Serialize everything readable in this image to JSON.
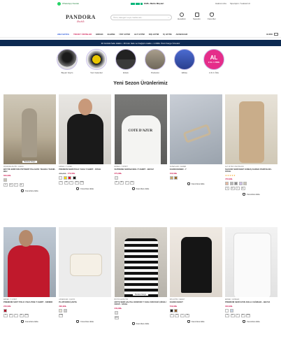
{
  "topbar": {
    "whatsapp": "WhatsApp Destek",
    "trustpilot": "1628+ Mutlu Müşteri",
    "links": [
      "Hakkımızda",
      "Siparişimi / İadeleriniz"
    ]
  },
  "logo": {
    "main": "PANDORA",
    "sub": "Butik"
  },
  "search": {
    "placeholder": "Ürün, kategori veya marka ara..."
  },
  "header_icons": [
    {
      "name": "user",
      "label": "Hesabım"
    },
    {
      "name": "bag",
      "label": "Sepetim"
    },
    {
      "name": "heart",
      "label": "Favoriler"
    }
  ],
  "nav": {
    "items": [
      "ANA SAYFA",
      "TRIVET ÜRÜNLER",
      "ERKEK",
      "ELBİSE",
      "ÜST GİYİM",
      "ALT GİYİM",
      "DIŞ GİYİM",
      "İÇ GİYİM",
      "AKSESUAR"
    ],
    "lang": "EURO",
    "flag": "TR"
  },
  "promo": {
    "text": "30 Günlük İade Hakkı • 18 Gün İade ve Değişim Hakkı • 1.000₺ Üzeri Kargo Ücretsiz"
  },
  "categories": [
    "Beyaz Giyim",
    "Yeni Gelenler",
    "Erkek",
    "Pantolon",
    "Elbise",
    "2 Al 1 Öde"
  ],
  "promo_cat": {
    "big": "AL",
    "small": "2 AL 1 ÖDE"
  },
  "section_title": "Yeni Sezon Ürünlerimiz",
  "row1": [
    {
      "brand": "PANDORA BUTİK / KADIN",
      "name": "BÜYÜK EDİSYON POTDERT PALAZZO YELEKLİ TAKIM - BEJ",
      "price": "849,99₺",
      "old": "",
      "tag": "Bedava Kargo",
      "stars": "",
      "colors": [
        "#c9c3b5"
      ],
      "sizes": [
        "S",
        "M",
        "L",
        "XL"
      ]
    },
    {
      "brand": "ERKEK / T-SHIRT",
      "name": "PREMIUM SERİ POLO YAKA T-SHIRT - SİYAH",
      "price": "279,99₺",
      "old": "399,99₺",
      "tag": "",
      "stars": "",
      "colors": [
        "#f2f2f2",
        "#f5d800",
        "#d81b28",
        "#111111"
      ],
      "sizes": [
        "S",
        "M",
        "L",
        "XL",
        "XXL"
      ]
    },
    {
      "brand": "ERKEK / T-SHIRT",
      "name": "SUPREME SERİ BASKILI T-SHIRT - BEYAZ",
      "price": "279,99₺",
      "old": "",
      "tag": "",
      "stars": "",
      "colors": [
        "#e8e8e8"
      ],
      "sizes": [
        "S",
        "M",
        "L",
        "XL"
      ]
    },
    {
      "brand": "AKSESUAR / KEMER",
      "name": "KADIN KEMER - Y",
      "price": "199,99₺",
      "old": "",
      "tag": "",
      "stars": "",
      "colors": [
        "#c8a56a",
        "#9a6a2c"
      ],
      "sizes": []
    },
    {
      "brand": "ALT GİYİM / PANTOLON",
      "name": "SALVOR SERİ KEEP KUMAŞ KARGO PANTOLON - SİYAH",
      "price": "479,99₺",
      "old": "",
      "tag": "",
      "stars": "★★★★★",
      "colors": [
        "#e5b8a0",
        "#b7b7b7",
        "#8a8a8a",
        "#cfc0e6",
        "#c9c3b5"
      ],
      "sizes": [
        "S",
        "M",
        "L",
        "XL"
      ]
    }
  ],
  "row2": [
    {
      "brand": "ERKEK / T-SHIRT",
      "name": "PREMIUM SOFT POLO YAKA PIKE T-SHIRT - KIRMIZI",
      "price": "249,99₺",
      "old": "",
      "tag": "",
      "stars": "",
      "colors": [
        "#b3122a"
      ],
      "sizes": [
        "S",
        "M",
        "L",
        "XL",
        "XXL"
      ]
    },
    {
      "brand": "AKSESUAR / ÇANTA",
      "name": "PLATFORM ÇANTA",
      "price": "399,99₺",
      "old": "",
      "tag": "",
      "stars": "",
      "colors": [
        "#e8e2d6",
        "#cfcfcf"
      ],
      "sizes": [
        "STD"
      ]
    },
    {
      "brand": "BÜYÜK EDİSYON",
      "name": "ÇİFTE SERİ HALTAL KONFOR T-YAKA KRUVAZİ ÇİZGİLİ CROP - SİYAH",
      "price": "349,99₺",
      "old": "",
      "tag": "Bedava Kargo",
      "stars": "",
      "colors": [
        "#e0e0e0"
      ],
      "sizes": [
        "STD"
      ]
    },
    {
      "brand": "DIŞ GİYİM / CEKET",
      "name": "KADIN CEKET",
      "price": "549,99₺",
      "old": "",
      "tag": "",
      "stars": "",
      "colors": [
        "#1a1a1a",
        "#8a5a2a"
      ],
      "sizes": [
        "S",
        "M",
        "L",
        "XL"
      ]
    },
    {
      "brand": "ERKEK / GÖMLEK",
      "name": "PREMIUM SERİ UZUN KOLLU GÖMLEK - BEYAZ",
      "price": "349,99₺",
      "old": "",
      "tag": "",
      "stars": "",
      "colors": [
        "#ffffff",
        "#c8d4e6"
      ],
      "sizes": [
        "S",
        "M",
        "L",
        "XL",
        "XXL"
      ]
    }
  ],
  "fav_label": "Favorilere Ekle"
}
